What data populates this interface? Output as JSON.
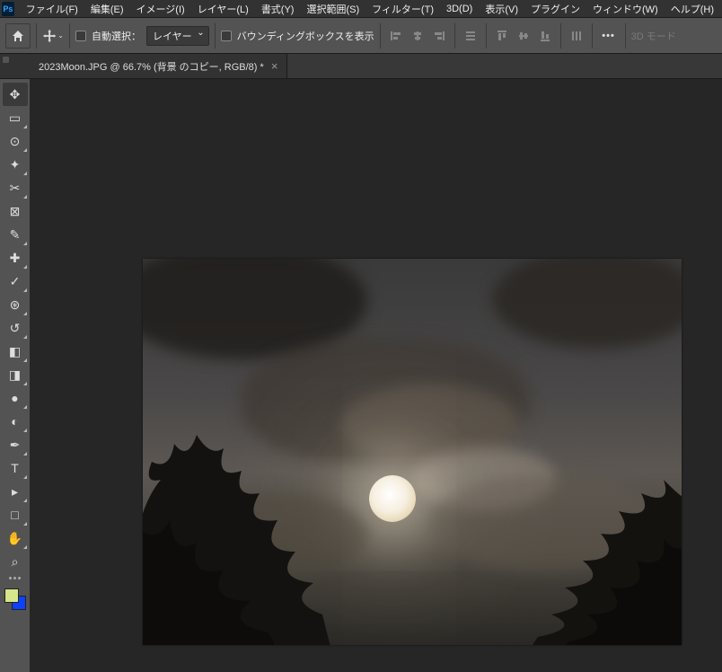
{
  "app_logo": "Ps",
  "menu": {
    "file": "ファイル(F)",
    "edit": "編集(E)",
    "image": "イメージ(I)",
    "layer": "レイヤー(L)",
    "type": "書式(Y)",
    "select": "選択範囲(S)",
    "filter": "フィルター(T)",
    "threed": "3D(D)",
    "view": "表示(V)",
    "plugins": "プラグイン",
    "window": "ウィンドウ(W)",
    "help": "ヘルプ(H)"
  },
  "options": {
    "auto_select_label": "自動選択：",
    "auto_select_value": "レイヤー",
    "show_transform_label": "バウンディングボックスを表示",
    "threed_mode": "3D モード"
  },
  "document": {
    "tab_title": "2023Moon.JPG @ 66.7% (背景 のコピー, RGB/8) *"
  },
  "colors": {
    "foreground": "#d6e68a",
    "background": "#1040ff"
  },
  "tools": [
    {
      "name": "move-tool",
      "glyph": "✥",
      "active": true,
      "sub": false
    },
    {
      "name": "rect-marquee-tool",
      "glyph": "▭",
      "sub": true
    },
    {
      "name": "lasso-tool",
      "glyph": "⊙",
      "sub": true
    },
    {
      "name": "magic-wand-tool",
      "glyph": "✦",
      "sub": true
    },
    {
      "name": "crop-tool",
      "glyph": "✂",
      "sub": true
    },
    {
      "name": "frame-tool",
      "glyph": "⊠",
      "sub": false
    },
    {
      "name": "eyedropper-tool",
      "glyph": "✎",
      "sub": true
    },
    {
      "name": "healing-brush-tool",
      "glyph": "✚",
      "sub": true
    },
    {
      "name": "brush-tool",
      "glyph": "✓",
      "sub": true
    },
    {
      "name": "clone-stamp-tool",
      "glyph": "⊛",
      "sub": true
    },
    {
      "name": "history-brush-tool",
      "glyph": "↺",
      "sub": true
    },
    {
      "name": "eraser-tool",
      "glyph": "◧",
      "sub": true
    },
    {
      "name": "gradient-tool",
      "glyph": "◨",
      "sub": true
    },
    {
      "name": "blur-tool",
      "glyph": "●",
      "sub": true
    },
    {
      "name": "dodge-tool",
      "glyph": "◐",
      "sub": true
    },
    {
      "name": "pen-tool",
      "glyph": "✒",
      "sub": true
    },
    {
      "name": "type-tool",
      "glyph": "T",
      "sub": true
    },
    {
      "name": "path-select-tool",
      "glyph": "▸",
      "sub": true
    },
    {
      "name": "rectangle-tool",
      "glyph": "□",
      "sub": true
    },
    {
      "name": "hand-tool",
      "glyph": "✋",
      "sub": true
    },
    {
      "name": "zoom-tool",
      "glyph": "⌕",
      "sub": false
    }
  ]
}
